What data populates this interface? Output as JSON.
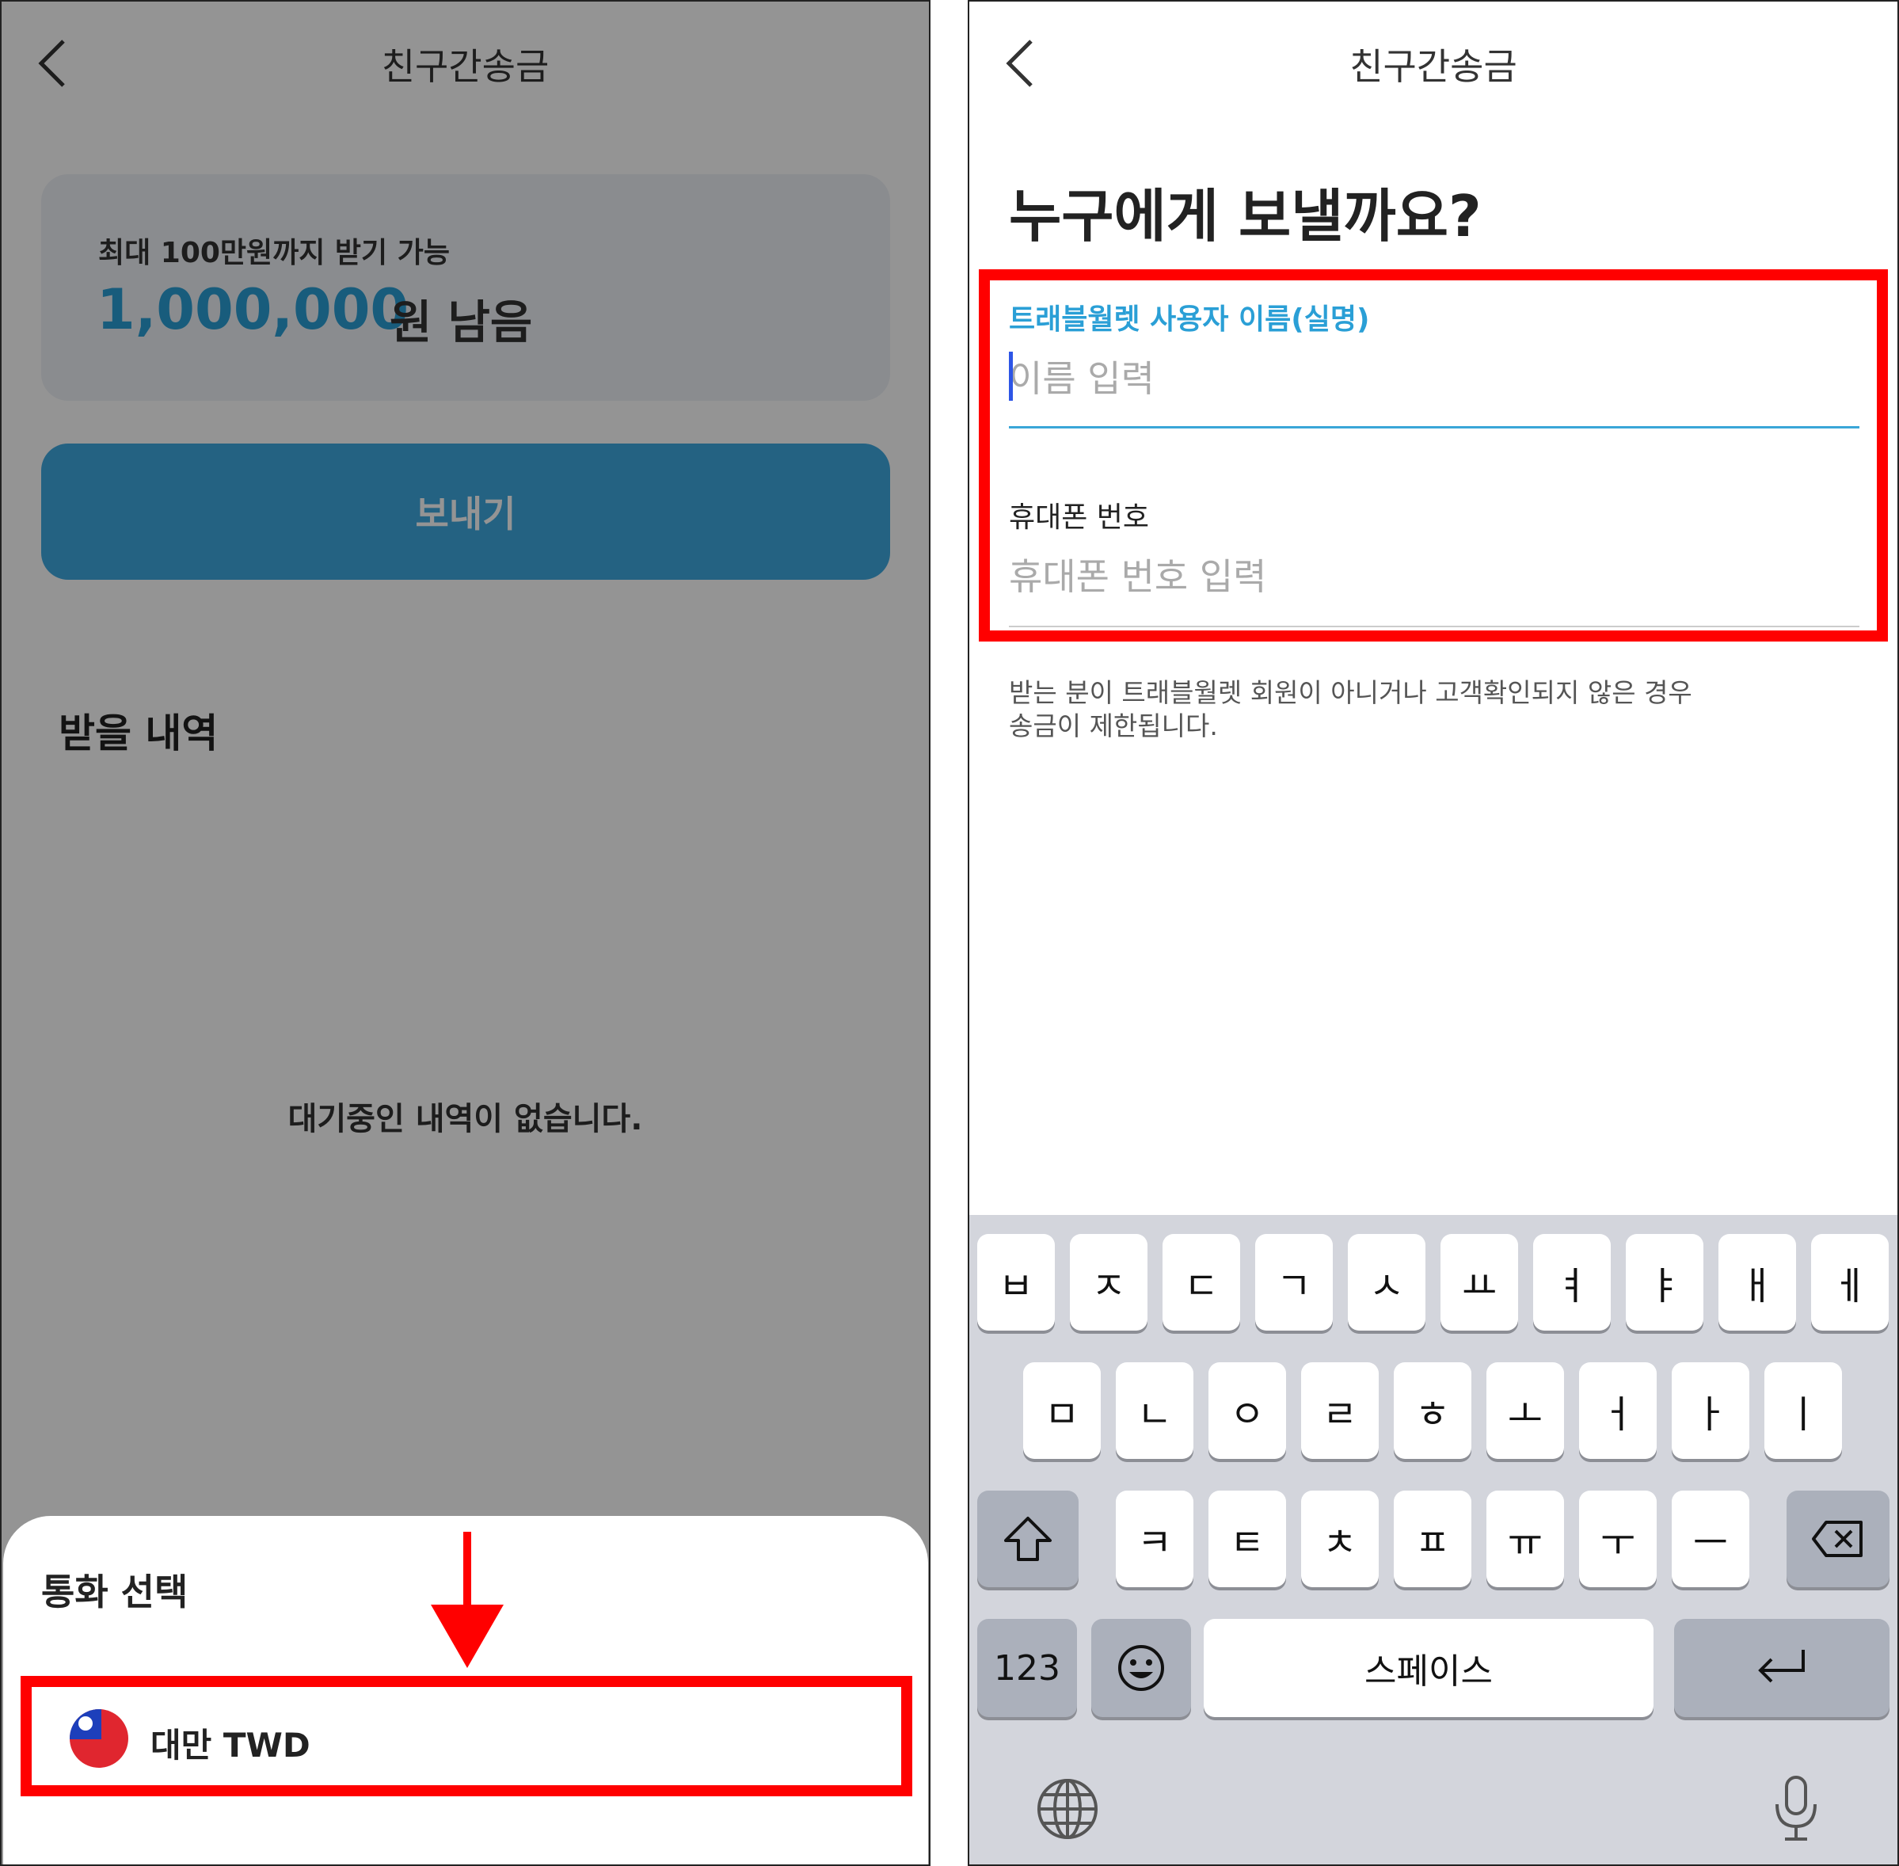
{
  "left": {
    "nav_title": "친구간송금",
    "limit_label": "최대 100만원까지 받기 가능",
    "limit_amount": "1,000,000",
    "limit_suffix": "원 남음",
    "send_button": "보내기",
    "section_title": "받을 내역",
    "empty_message": "대기중인 내역이 없습니다.",
    "sheet_title": "통화 선택",
    "currency_option": "대만 TWD"
  },
  "right": {
    "nav_title": "친구간송금",
    "question": "누구에게 보낼까요?",
    "name_label": "트래블월렛 사용자 이름(실명)",
    "name_placeholder": "이름 입력",
    "phone_label": "휴대폰 번호",
    "phone_placeholder": "휴대폰 번호 입력",
    "notice_line1": "받는 분이 트래블월렛 회원이 아니거나 고객확인되지 않은 경우",
    "notice_line2": "송금이 제한됩니다."
  },
  "keyboard": {
    "row1": [
      "ㅂ",
      "ㅈ",
      "ㄷ",
      "ㄱ",
      "ㅅ",
      "ㅛ",
      "ㅕ",
      "ㅑ",
      "ㅐ",
      "ㅔ"
    ],
    "row2": [
      "ㅁ",
      "ㄴ",
      "ㅇ",
      "ㄹ",
      "ㅎ",
      "ㅗ",
      "ㅓ",
      "ㅏ",
      "ㅣ"
    ],
    "row3": [
      "ㅋ",
      "ㅌ",
      "ㅊ",
      "ㅍ",
      "ㅠ",
      "ㅜ",
      "ㅡ"
    ],
    "numbers_key": "123",
    "space_key": "스페이스"
  },
  "colors": {
    "accent_blue": "#2a9fd6",
    "highlight_red": "#ff0000"
  }
}
